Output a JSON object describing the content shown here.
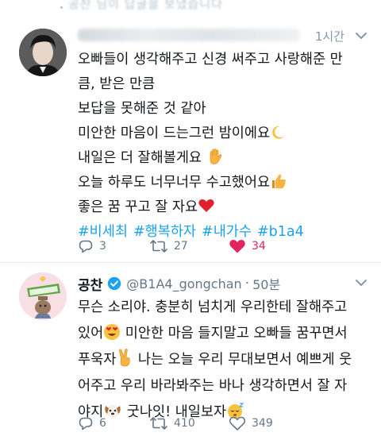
{
  "prev_tweet": {
    "fragment": "공찬 님이 답글을 보냈습니다"
  },
  "tweet1": {
    "time": "1시간",
    "lines": [
      "오빠들이 생각해주고 신경 써주고 사랑해준 만",
      "큼, 받은 만큼",
      "보답을 못해준 것 같아",
      "미안한 마음이 드는그런 밤이에요",
      "내일은 더 잘해볼게요",
      "오늘 하루도 너무너무 수고했어요",
      "좋은 꿈 꾸고 잘 자요"
    ],
    "hashtags": [
      "#비세최",
      "#행복하자",
      "#내가수",
      "#b1a4"
    ],
    "replies": "3",
    "retweets": "27",
    "likes": "34",
    "icons": {
      "moon": "crescent-moon-emoji",
      "hand": "raised-hand-emoji",
      "thumb": "thumbs-up-emoji",
      "heart": "red-heart-emoji"
    }
  },
  "tweet2": {
    "name": "공찬",
    "handle": "@B1A4_gongchan",
    "separator": "·",
    "time": "50분",
    "lines": [
      "무슨 소리야. 충분히 넘치게 우리한테 잘해주고",
      "있어",
      "미안한 마음 들지말고 오빠들 꿈꾸면서",
      "푸욱자",
      "나는 오늘 우리 무대보면서 예쁘게 웃",
      "어주고 우리 바라봐주는 바나 생각하면서 잘 자",
      "야지",
      "굿나잇! 내일보자"
    ],
    "replies": "6",
    "retweets": "410",
    "likes": "349"
  },
  "colors": {
    "link": "#1da1f2",
    "muted": "#657786",
    "like": "#e0245e",
    "text": "#14171a"
  }
}
